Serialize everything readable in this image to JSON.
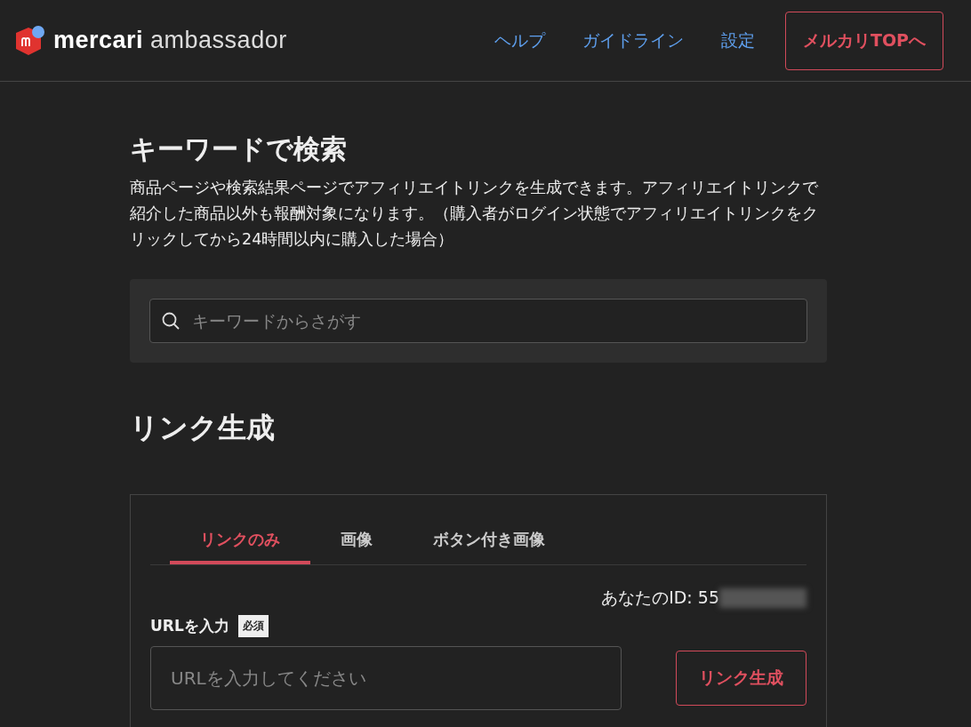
{
  "header": {
    "logo": {
      "brand": "mercari",
      "product": "ambassador"
    },
    "nav": [
      {
        "label": "ヘルプ",
        "kind": "link"
      },
      {
        "label": "ガイドライン",
        "kind": "link"
      },
      {
        "label": "設定",
        "kind": "link"
      },
      {
        "label": "メルカリTOPへ",
        "kind": "button"
      }
    ]
  },
  "search_section": {
    "title": "キーワードで検索",
    "description": "商品ページや検索結果ページでアフィリエイトリンクを生成できます。アフィリエイトリンクで紹介した商品以外も報酬対象になります。（購入者がログイン状態でアフィリエイトリンクをクリックしてから24時間以内に購入した場合）",
    "search": {
      "placeholder": "キーワードからさがす"
    }
  },
  "link_section": {
    "title": "リンク生成",
    "tabs": [
      {
        "label": "リンクのみ",
        "selected": true
      },
      {
        "label": "画像",
        "selected": false
      },
      {
        "label": "ボタン付き画像",
        "selected": false
      }
    ],
    "your_id": "あなたのID: 55",
    "id_redacted": true,
    "url_label": "URLを入力",
    "required_badge": "必須",
    "url_field": {
      "placeholder": "URLを入力してください"
    },
    "generate_button": "リンク生成"
  }
}
